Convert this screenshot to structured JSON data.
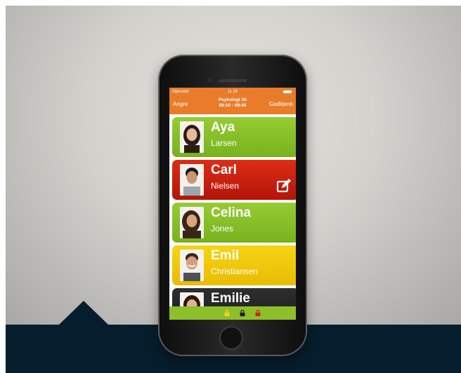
{
  "status_bar": {
    "operator": "Operatør",
    "time": "11.33"
  },
  "nav": {
    "left_label": "Angre",
    "title_line1": "Psykologi 3b",
    "title_line2": "08:10 - 09:40",
    "right_label": "Godkjenn"
  },
  "students": [
    {
      "first": "Aya",
      "last": "Larsen",
      "status": "green"
    },
    {
      "first": "Carl",
      "last": "Nielsen",
      "status": "red"
    },
    {
      "first": "Celina",
      "last": "Jones",
      "status": "green"
    },
    {
      "first": "Emil",
      "last": "Christiansen",
      "status": "yellow"
    },
    {
      "first": "Emilie",
      "last": "",
      "status": "dark"
    }
  ],
  "colors": {
    "appbar": "#e87c2a",
    "present": "#86c226",
    "absent": "#c81f0e",
    "late": "#efc70a",
    "dark": "#222222",
    "footer_band": "#061d2d"
  },
  "icons": {
    "edit": "edit-icon",
    "bottom_locks": [
      "lock-icon-yellow",
      "lock-icon-black",
      "lock-icon-red"
    ]
  }
}
